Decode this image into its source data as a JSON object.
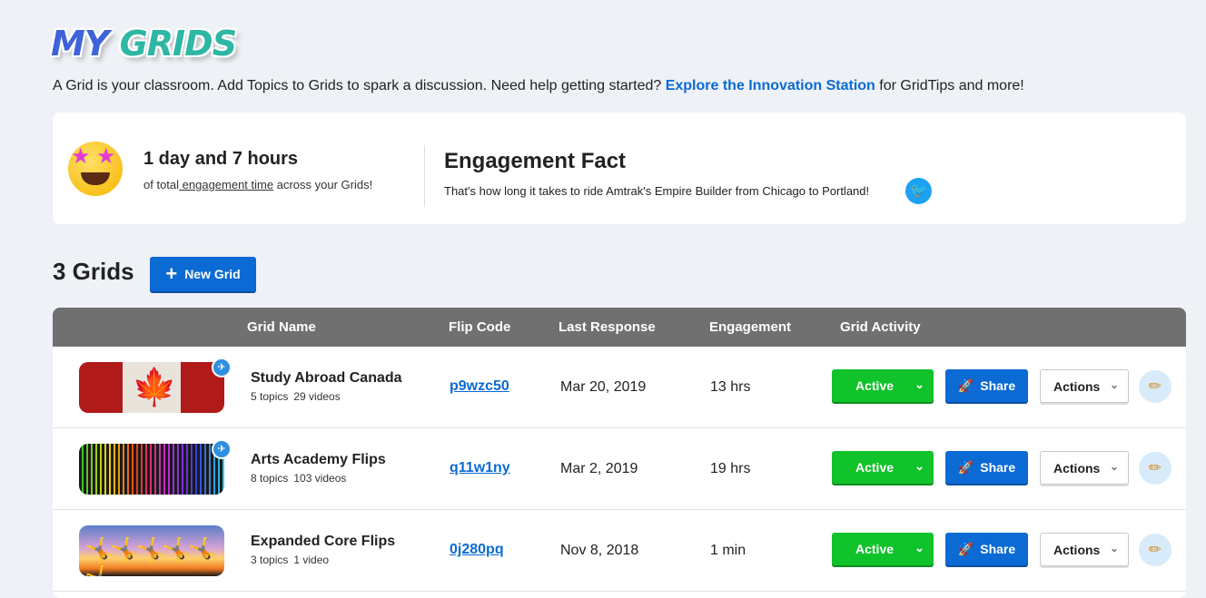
{
  "logo": {
    "text_a": "MY ",
    "text_b": "GRIDS"
  },
  "intro": {
    "text_before": "A Grid is your classroom. Add Topics to Grids to spark a discussion. Need help getting started? ",
    "link": "Explore the Innovation Station",
    "text_after": " for GridTips and more!"
  },
  "stats": {
    "value": "1 day and 7 hours",
    "desc_before": "of total",
    "desc_link": " engagement time",
    "desc_after": " across your Grids!",
    "icon": "star-struck-emoji-icon"
  },
  "fact": {
    "title": "Engagement Fact",
    "text": "That's how long it takes to ride Amtrak's Empire Builder from Chicago to Portland!",
    "icon": "twitter-icon"
  },
  "grids": {
    "count_label": "3 Grids",
    "new_button": "New Grid"
  },
  "table": {
    "headers": [
      "Grid Name",
      "Flip Code",
      "Last Response",
      "Engagement",
      "Grid Activity"
    ],
    "rows": [
      {
        "name": "Study Abroad Canada",
        "topics": "5 topics",
        "videos": "29 videos",
        "code": "p9wzc50",
        "last": "Mar 20, 2019",
        "engagement": "13 hrs",
        "status": "Active",
        "share": "Share",
        "actions": "Actions"
      },
      {
        "name": "Arts Academy Flips",
        "topics": "8 topics",
        "videos": "103 videos",
        "code": "q11w1ny",
        "last": "Mar 2, 2019",
        "engagement": "19 hrs",
        "status": "Active",
        "share": "Share",
        "actions": "Actions"
      },
      {
        "name": "Expanded Core Flips",
        "topics": "3 topics",
        "videos": "1 video",
        "code": "0j280pq",
        "last": "Nov 8, 2018",
        "engagement": "1 min",
        "status": "Active",
        "share": "Share",
        "actions": "Actions"
      }
    ]
  },
  "colors": {
    "primary": "#0b6ad3",
    "active": "#10c32a",
    "header_bg": "#707070",
    "page_bg": "#eef1f6"
  }
}
